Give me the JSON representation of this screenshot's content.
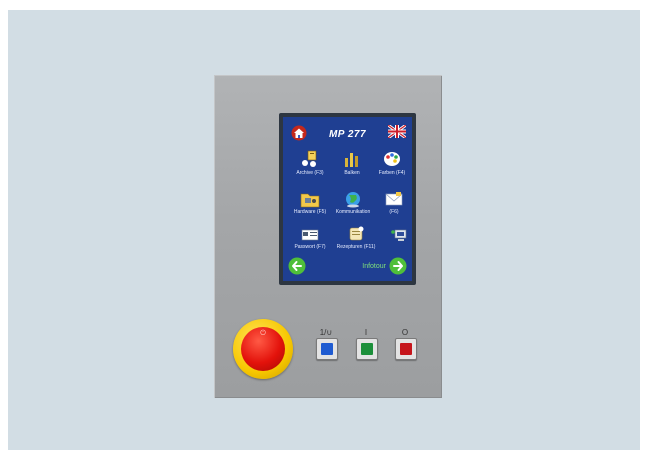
{
  "device": {
    "model_title": "MP 277",
    "language_flag_icon": "uk-flag-icon",
    "home_icon": "home-icon",
    "tiles": [
      {
        "label": "Archive (F3)",
        "icon": "archive-icon"
      },
      {
        "label": "Balken",
        "icon": "bar-chart-icon"
      },
      {
        "label": "Farben (F4)",
        "icon": "palette-icon"
      },
      {
        "label": "Hardware (F5)",
        "icon": "hardware-folder-icon"
      },
      {
        "label": "Kommunikation",
        "icon": "globe-icon"
      },
      {
        "label": "(F6)",
        "icon": "envelope-icon"
      },
      {
        "label": "Passwort (F7)",
        "icon": "password-card-icon"
      },
      {
        "label": "Rezepturen (F11)",
        "icon": "recipe-icon"
      },
      {
        "label": "",
        "icon": "computer-icon"
      }
    ],
    "nav": {
      "back_icon": "arrow-left-icon",
      "forward_icon": "arrow-right-icon",
      "infotour_label": "Infotour"
    },
    "keys": [
      {
        "label": "1/∪",
        "color": "#1f5bd1",
        "name": "blue-key"
      },
      {
        "label": "I",
        "color": "#1c8f3a",
        "name": "green-key"
      },
      {
        "label": "O",
        "color": "#c6151b",
        "name": "red-key"
      }
    ],
    "colors": {
      "screen_bg": "#1f3f92",
      "emergency_stop_red": "#e3120b",
      "emergency_stop_yellow": "#f7c700",
      "infotour_green": "#7fe07a"
    }
  }
}
